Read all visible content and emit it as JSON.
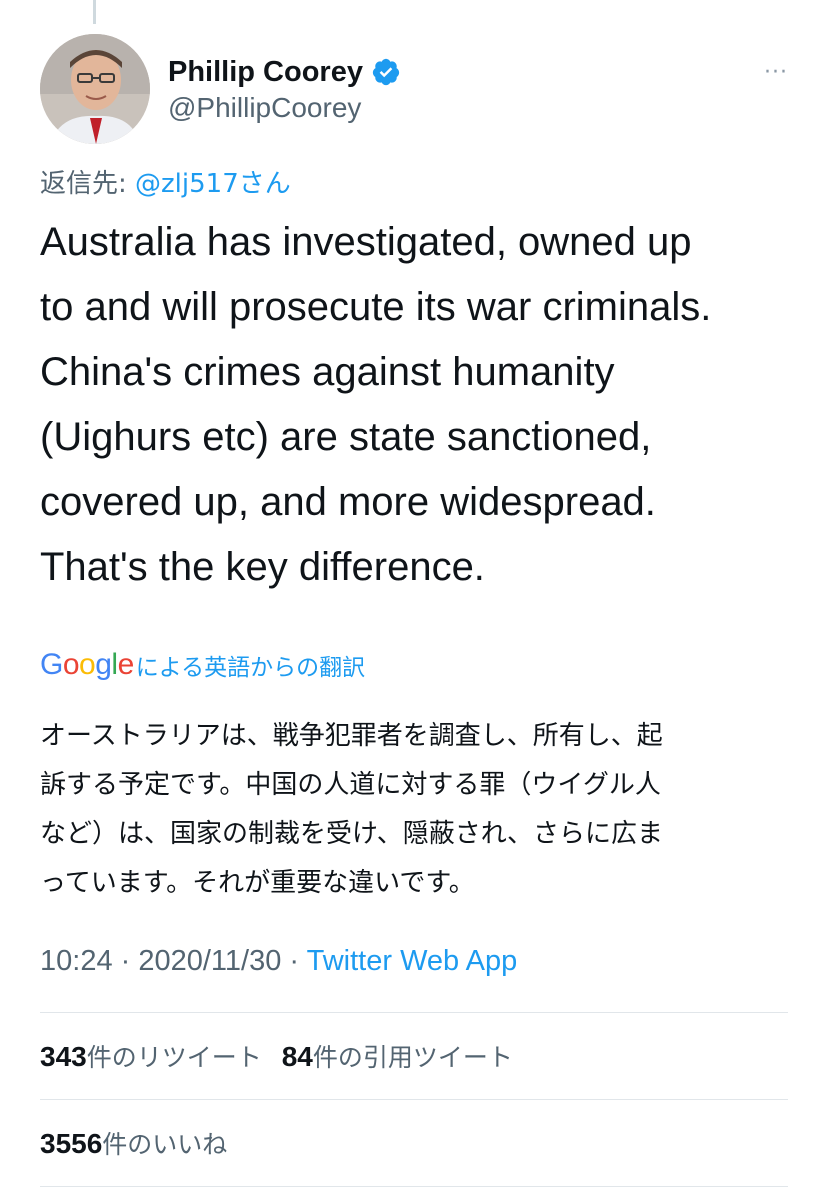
{
  "tweet": {
    "display_name": "Phillip Coorey",
    "handle": "@PhillipCoorey",
    "more_icon": "···",
    "reply_prefix": "返信先: ",
    "reply_mention": "@zlj517さん",
    "text": "Australia has investigated, owned up\nto and will prosecute its war criminals.\nChina's crimes against humanity\n(Uighurs etc) are state sanctioned,\ncovered up, and more widespread.\nThat's the key difference.",
    "translation_label": "による英語からの翻訳",
    "translation_text": "オーストラリアは、戦争犯罪者を調査し、所有し、起\n訴する予定です。中国の人道に対する罪（ウイグル人\nなど）は、国家の制裁を受け、隠蔽され、さらに広ま\nっています。それが重要な違いです。",
    "time": "10:24",
    "date": "2020/11/30",
    "separator": " · ",
    "app": "Twitter Web App"
  },
  "google_logo": {
    "letters": [
      "G",
      "o",
      "o",
      "g",
      "l",
      "e"
    ],
    "colors": [
      "#4285F4",
      "#EA4335",
      "#FBBC05",
      "#4285F4",
      "#34A853",
      "#EA4335"
    ]
  },
  "stats": {
    "retweets_count": "343",
    "retweets_label": "件のリツイート",
    "quotes_count": "84",
    "quotes_label": "件の引用ツイート",
    "likes_count": "3556",
    "likes_label": "件のいいね"
  },
  "colors": {
    "accent": "#1d9bf0",
    "secondary_text": "#536471",
    "primary_text": "#0f1419"
  }
}
